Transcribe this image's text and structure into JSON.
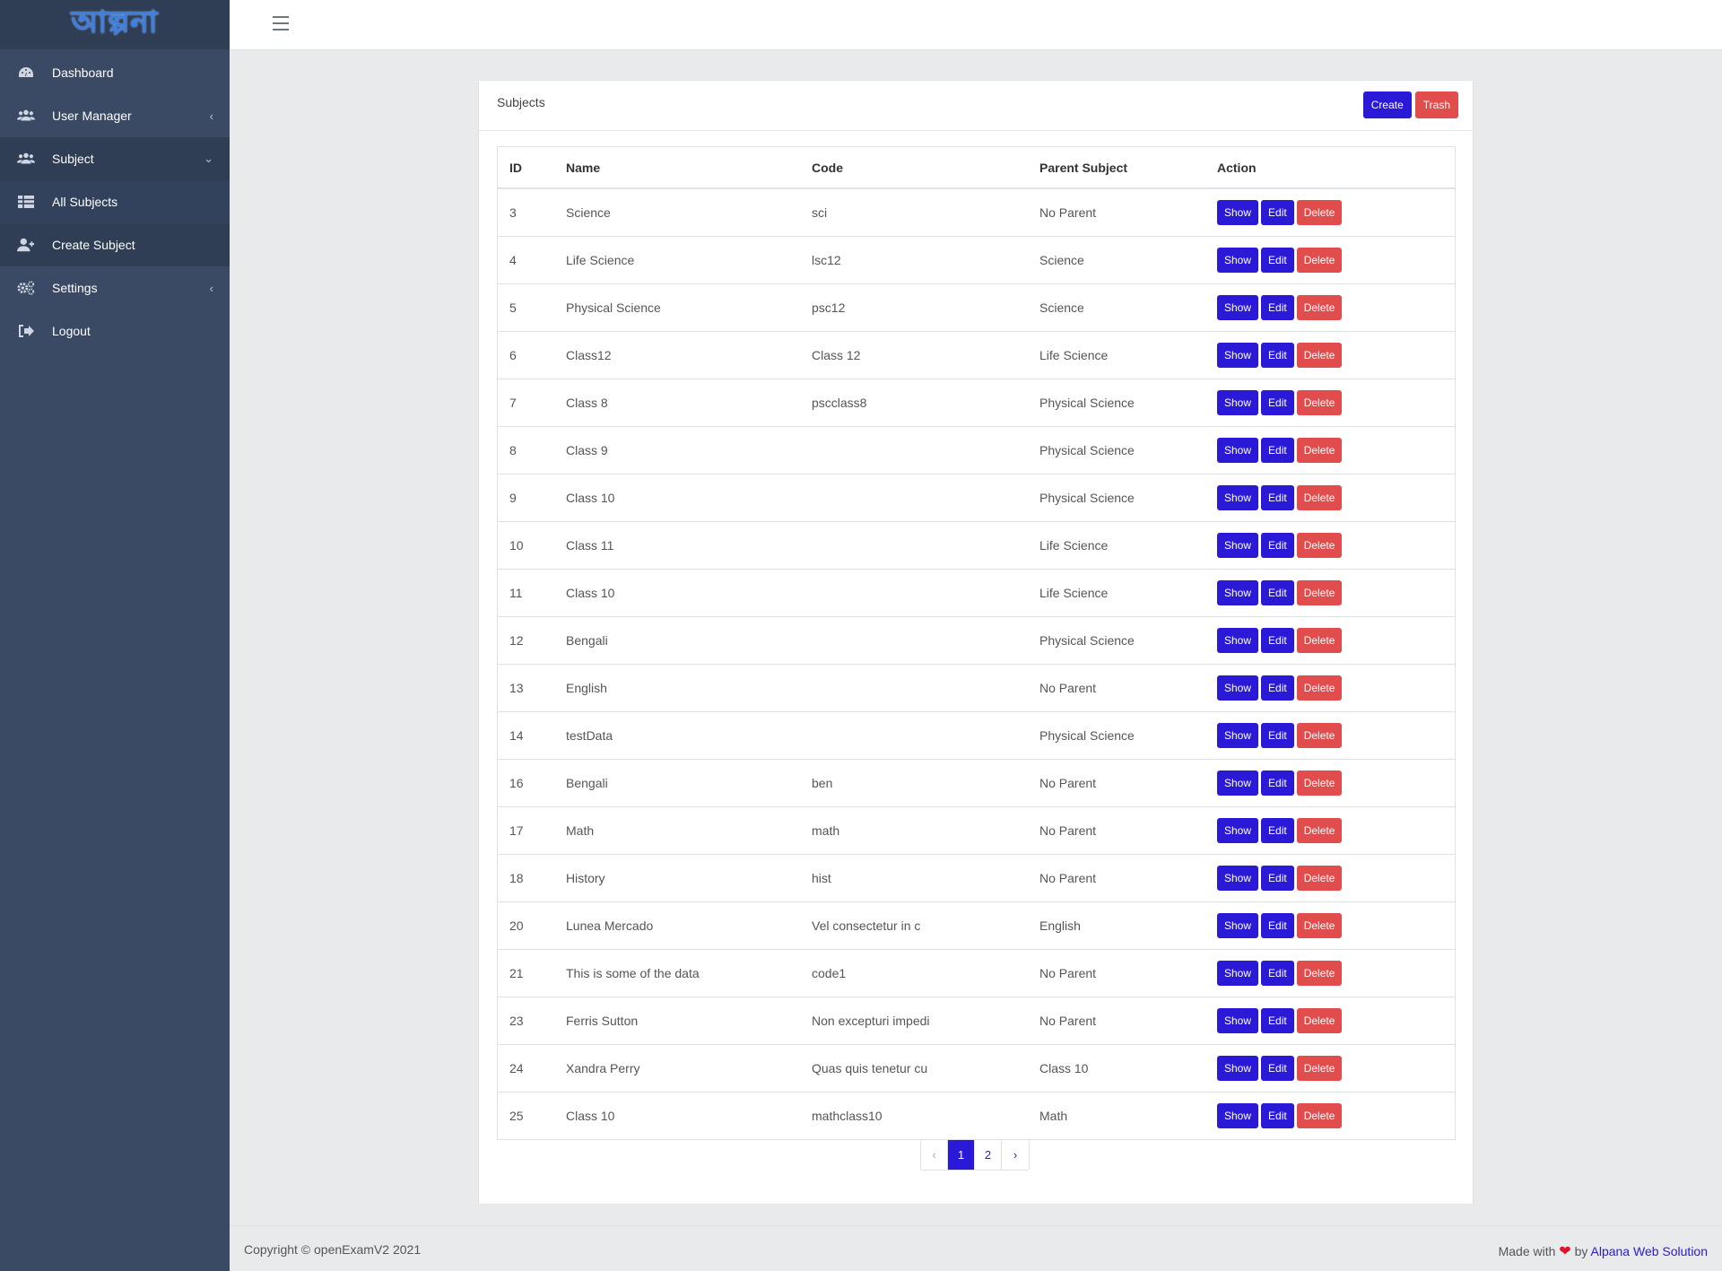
{
  "brand": {
    "logo_text": "আল্পনা"
  },
  "sidebar": {
    "items": [
      {
        "label": "Dashboard",
        "icon": "dashboard-icon"
      },
      {
        "label": "User Manager",
        "icon": "users-icon",
        "chevron": "‹"
      },
      {
        "label": "Subject",
        "icon": "users-icon",
        "chevron": "⌄"
      },
      {
        "label": "All Subjects",
        "icon": "table-icon"
      },
      {
        "label": "Create Subject",
        "icon": "user-plus-icon"
      },
      {
        "label": "Settings",
        "icon": "cogs-icon",
        "chevron": "‹"
      },
      {
        "label": "Logout",
        "icon": "sign-out-icon"
      }
    ]
  },
  "card": {
    "title": "Subjects",
    "create_label": "Create",
    "trash_label": "Trash"
  },
  "table": {
    "headers": [
      "ID",
      "Name",
      "Code",
      "Parent Subject",
      "Action"
    ],
    "action_labels": {
      "show": "Show",
      "edit": "Edit",
      "delete": "Delete"
    },
    "rows": [
      [
        "3",
        "Science",
        "sci",
        "No Parent"
      ],
      [
        "4",
        "Life Science",
        "lsc12",
        "Science"
      ],
      [
        "5",
        "Physical Science",
        "psc12",
        "Science"
      ],
      [
        "6",
        "Class12",
        "Class 12",
        "Life Science"
      ],
      [
        "7",
        "Class 8",
        "pscclass8",
        "Physical Science"
      ],
      [
        "8",
        "Class 9",
        "",
        "Physical Science"
      ],
      [
        "9",
        "Class 10",
        "",
        "Physical Science"
      ],
      [
        "10",
        "Class 11",
        "",
        "Life Science"
      ],
      [
        "11",
        "Class 10",
        "",
        "Life Science"
      ],
      [
        "12",
        "Bengali",
        "",
        "Physical Science"
      ],
      [
        "13",
        "English",
        "",
        "No Parent"
      ],
      [
        "14",
        "testData",
        "",
        "Physical Science"
      ],
      [
        "16",
        "Bengali",
        "ben",
        "No Parent"
      ],
      [
        "17",
        "Math",
        "math",
        "No Parent"
      ],
      [
        "18",
        "History",
        "hist",
        "No Parent"
      ],
      [
        "20",
        "Lunea Mercado",
        "Vel consectetur in c",
        "English"
      ],
      [
        "21",
        "This is some of the data",
        "code1",
        "No Parent"
      ],
      [
        "23",
        "Ferris Sutton",
        "Non excepturi impedi",
        "No Parent"
      ],
      [
        "24",
        "Xandra Perry",
        "Quas quis tenetur cu",
        "Class 10"
      ],
      [
        "25",
        "Class 10",
        "mathclass10",
        "Math"
      ]
    ]
  },
  "pagination": {
    "prev": "‹",
    "pages": [
      "1",
      "2"
    ],
    "current": "1",
    "next": "›"
  },
  "footer": {
    "copyright": "Copyright © openExamV2 2021",
    "made_with": "Made with",
    "by": "by",
    "company": "Alpana Web Solution"
  },
  "colors": {
    "primary": "#2a1ad7",
    "danger": "#e14c4c",
    "sidebar": "#3b4a64"
  }
}
